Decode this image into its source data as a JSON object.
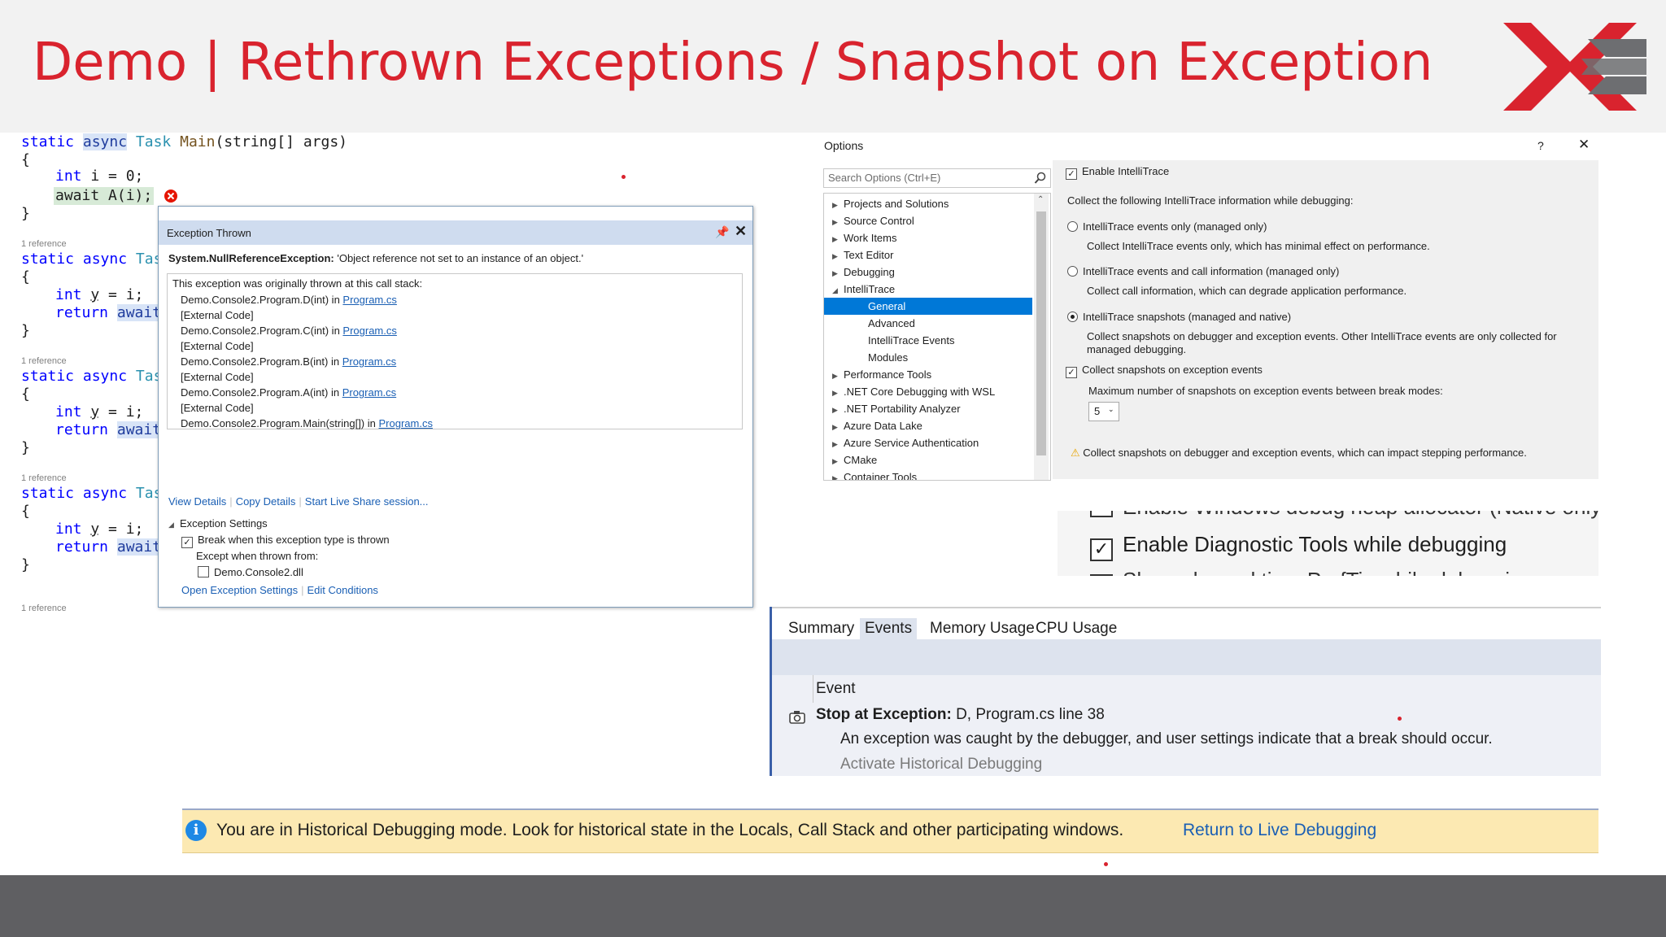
{
  "slide": {
    "title": "Demo | Rethrown Exceptions / Snapshot on Exception"
  },
  "colors": {
    "title_red": "#d9232e",
    "logo_red": "#d9232e",
    "logo_gray": "#6d6e71",
    "link_blue": "#1a5fb4",
    "info_bar": "#fce9b2",
    "selected_blue": "#0078d7"
  },
  "code": {
    "main_sig": {
      "kw1": "static",
      "kw2": "async",
      "type": "Task",
      "method": "Main",
      "params": "(string[] args)"
    },
    "open_brace": "{",
    "close_brace": "}",
    "line_int_i": "int i = 0;",
    "line_await": "await A(i);",
    "ref_label": "1 reference",
    "sig_static": "static",
    "sig_async": "async",
    "sig_tas": "Tas",
    "int_kw": "int",
    "y_var": "y",
    "eq_i": " = i;",
    "return_kw": "return",
    "await_kw": "await"
  },
  "exception_popup": {
    "title": "Exception Thrown",
    "exception_type": "System.NullReferenceException:",
    "exception_message": " 'Object reference not set to an instance of an object.'",
    "stack_header": "This exception was originally thrown at this call stack:",
    "stack": [
      {
        "text": "Demo.Console2.Program.D(int) in ",
        "file": "Program.cs"
      },
      {
        "text": "[External Code]",
        "file": ""
      },
      {
        "text": "Demo.Console2.Program.C(int) in ",
        "file": "Program.cs"
      },
      {
        "text": "[External Code]",
        "file": ""
      },
      {
        "text": "Demo.Console2.Program.B(int) in ",
        "file": "Program.cs"
      },
      {
        "text": "[External Code]",
        "file": ""
      },
      {
        "text": "Demo.Console2.Program.A(int) in ",
        "file": "Program.cs"
      },
      {
        "text": "[External Code]",
        "file": ""
      },
      {
        "text": "Demo.Console2.Program.Main(string[]) in ",
        "file": "Program.cs"
      }
    ],
    "actions": {
      "view_details": "View Details",
      "copy_details": "Copy Details",
      "live_share": "Start Live Share session..."
    },
    "settings": {
      "header": "Exception Settings",
      "break_when": "Break when this exception type is thrown",
      "except_when": "Except when thrown from:",
      "dll": "Demo.Console2.dll",
      "open_settings": "Open Exception Settings",
      "edit_conditions": "Edit Conditions"
    }
  },
  "options_dialog": {
    "title": "Options",
    "help": "?",
    "close": "✕",
    "search_placeholder": "Search Options (Ctrl+E)",
    "tree": [
      {
        "label": "Projects and Solutions",
        "level": 0,
        "expander": "▶"
      },
      {
        "label": "Source Control",
        "level": 0,
        "expander": "▶"
      },
      {
        "label": "Work Items",
        "level": 0,
        "expander": "▶"
      },
      {
        "label": "Text Editor",
        "level": 0,
        "expander": "▶"
      },
      {
        "label": "Debugging",
        "level": 0,
        "expander": "▶"
      },
      {
        "label": "IntelliTrace",
        "level": 0,
        "expander": "◢"
      },
      {
        "label": "General",
        "level": 1,
        "expander": "",
        "selected": true
      },
      {
        "label": "Advanced",
        "level": 1,
        "expander": ""
      },
      {
        "label": "IntelliTrace Events",
        "level": 1,
        "expander": ""
      },
      {
        "label": "Modules",
        "level": 1,
        "expander": ""
      },
      {
        "label": "Performance Tools",
        "level": 0,
        "expander": "▶"
      },
      {
        "label": ".NET Core Debugging with WSL",
        "level": 0,
        "expander": "▶"
      },
      {
        "label": ".NET Portability Analyzer",
        "level": 0,
        "expander": "▶"
      },
      {
        "label": "Azure Data Lake",
        "level": 0,
        "expander": "▶"
      },
      {
        "label": "Azure Service Authentication",
        "level": 0,
        "expander": "▶"
      },
      {
        "label": "CMake",
        "level": 0,
        "expander": "▶"
      },
      {
        "label": "Container Tools",
        "level": 0,
        "expander": "▶"
      }
    ],
    "enable_intellitrace": "Enable IntelliTrace",
    "collect_label": "Collect the following IntelliTrace information while debugging:",
    "radio1": "IntelliTrace events only (managed only)",
    "radio1_desc": "Collect IntelliTrace events only, which has minimal effect on performance.",
    "radio2": "IntelliTrace events and call information (managed only)",
    "radio2_desc": "Collect call information, which can degrade application performance.",
    "radio3": "IntelliTrace snapshots (managed and native)",
    "radio3_desc1": "Collect snapshots on debugger and exception events. Other IntelliTrace events are only collected for",
    "radio3_desc2": "managed debugging.",
    "collect_snapshots": "Collect snapshots on exception events",
    "max_label": "Maximum number of snapshots on exception events between break modes:",
    "max_value": "5",
    "warning": "Collect snapshots on debugger and exception events, which can impact stepping performance."
  },
  "debug_options_zoom": {
    "top_cut": "Enable Windows debug heap allocator (Native only)",
    "diag": "Enable Diagnostic Tools while debugging",
    "bottom_cut": "Show elapsed time PerfTip while debugging"
  },
  "diagnostic_tools": {
    "tabs": [
      "Summary",
      "Events",
      "Memory Usage",
      "CPU Usage"
    ],
    "column_event": "Event",
    "event_title": "Stop at Exception:",
    "event_location": " D, Program.cs line 38",
    "event_desc": "An exception was caught by the debugger, and user settings indicate that a break should occur.",
    "activate": "Activate Historical Debugging"
  },
  "info_bar": {
    "message": "You are in Historical Debugging mode. Look for historical state in the Locals, Call Stack and other participating windows.",
    "link": "Return to Live Debugging"
  }
}
